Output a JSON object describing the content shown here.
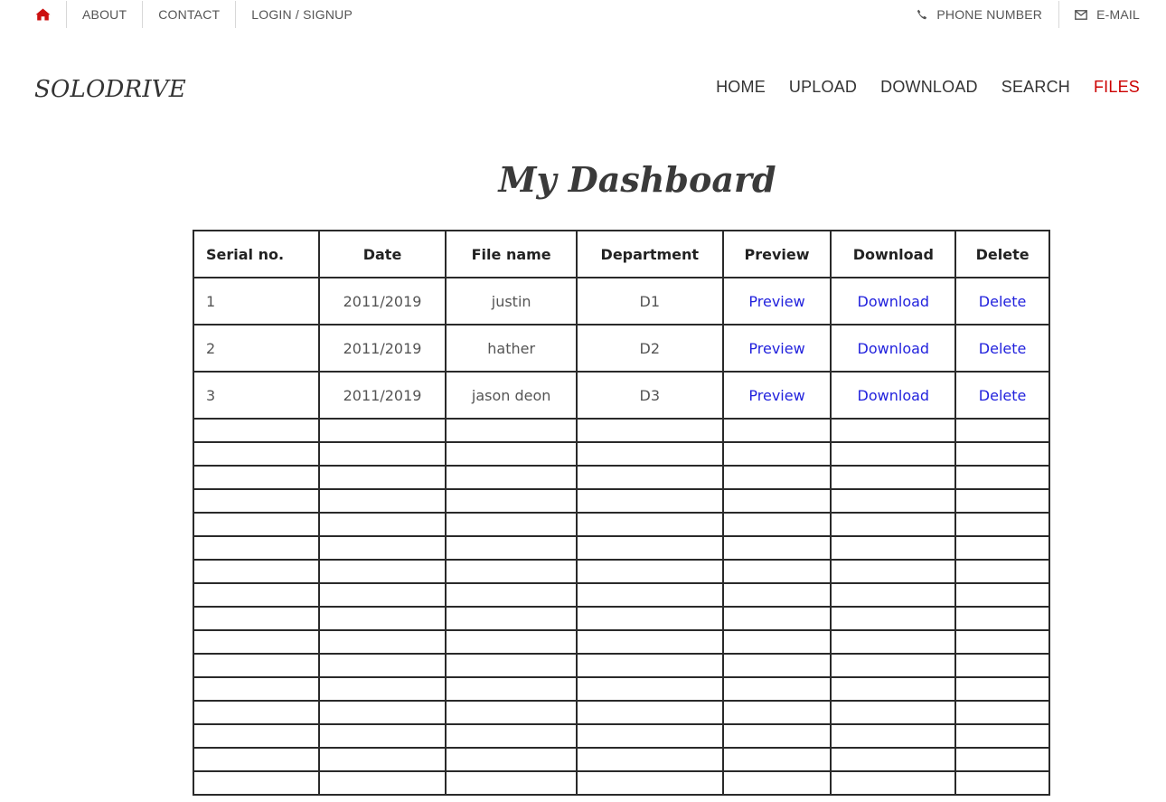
{
  "topbar": {
    "links": [
      "ABOUT",
      "CONTACT",
      "LOGIN / SIGNUP"
    ],
    "phone": "PHONE NUMBER",
    "email": "E-MAIL"
  },
  "brand": "SOLODRIVE",
  "nav": {
    "items": [
      "HOME",
      "UPLOAD",
      "DOWNLOAD",
      "SEARCH",
      "FILES"
    ],
    "active": "FILES",
    "active_color": "#cc0000"
  },
  "title": "My Dashboard",
  "table": {
    "headers": [
      "Serial no.",
      "Date",
      "File name",
      "Department",
      "Preview",
      "Download",
      "Delete"
    ],
    "rows": [
      [
        "1",
        "2011/2019",
        "justin",
        "D1",
        "Preview",
        "Download",
        "Delete"
      ],
      [
        "2",
        "2011/2019",
        "hather",
        "D2",
        "Preview",
        "Download",
        "Delete"
      ],
      [
        "3",
        "2011/2019",
        "jason deon",
        "D3",
        "Preview",
        "Download",
        "Delete"
      ]
    ],
    "empty_rows": 16,
    "link_color": "#2222dd"
  },
  "icons": {
    "home": "home-icon",
    "phone": "phone-icon",
    "email": "envelope-icon"
  }
}
